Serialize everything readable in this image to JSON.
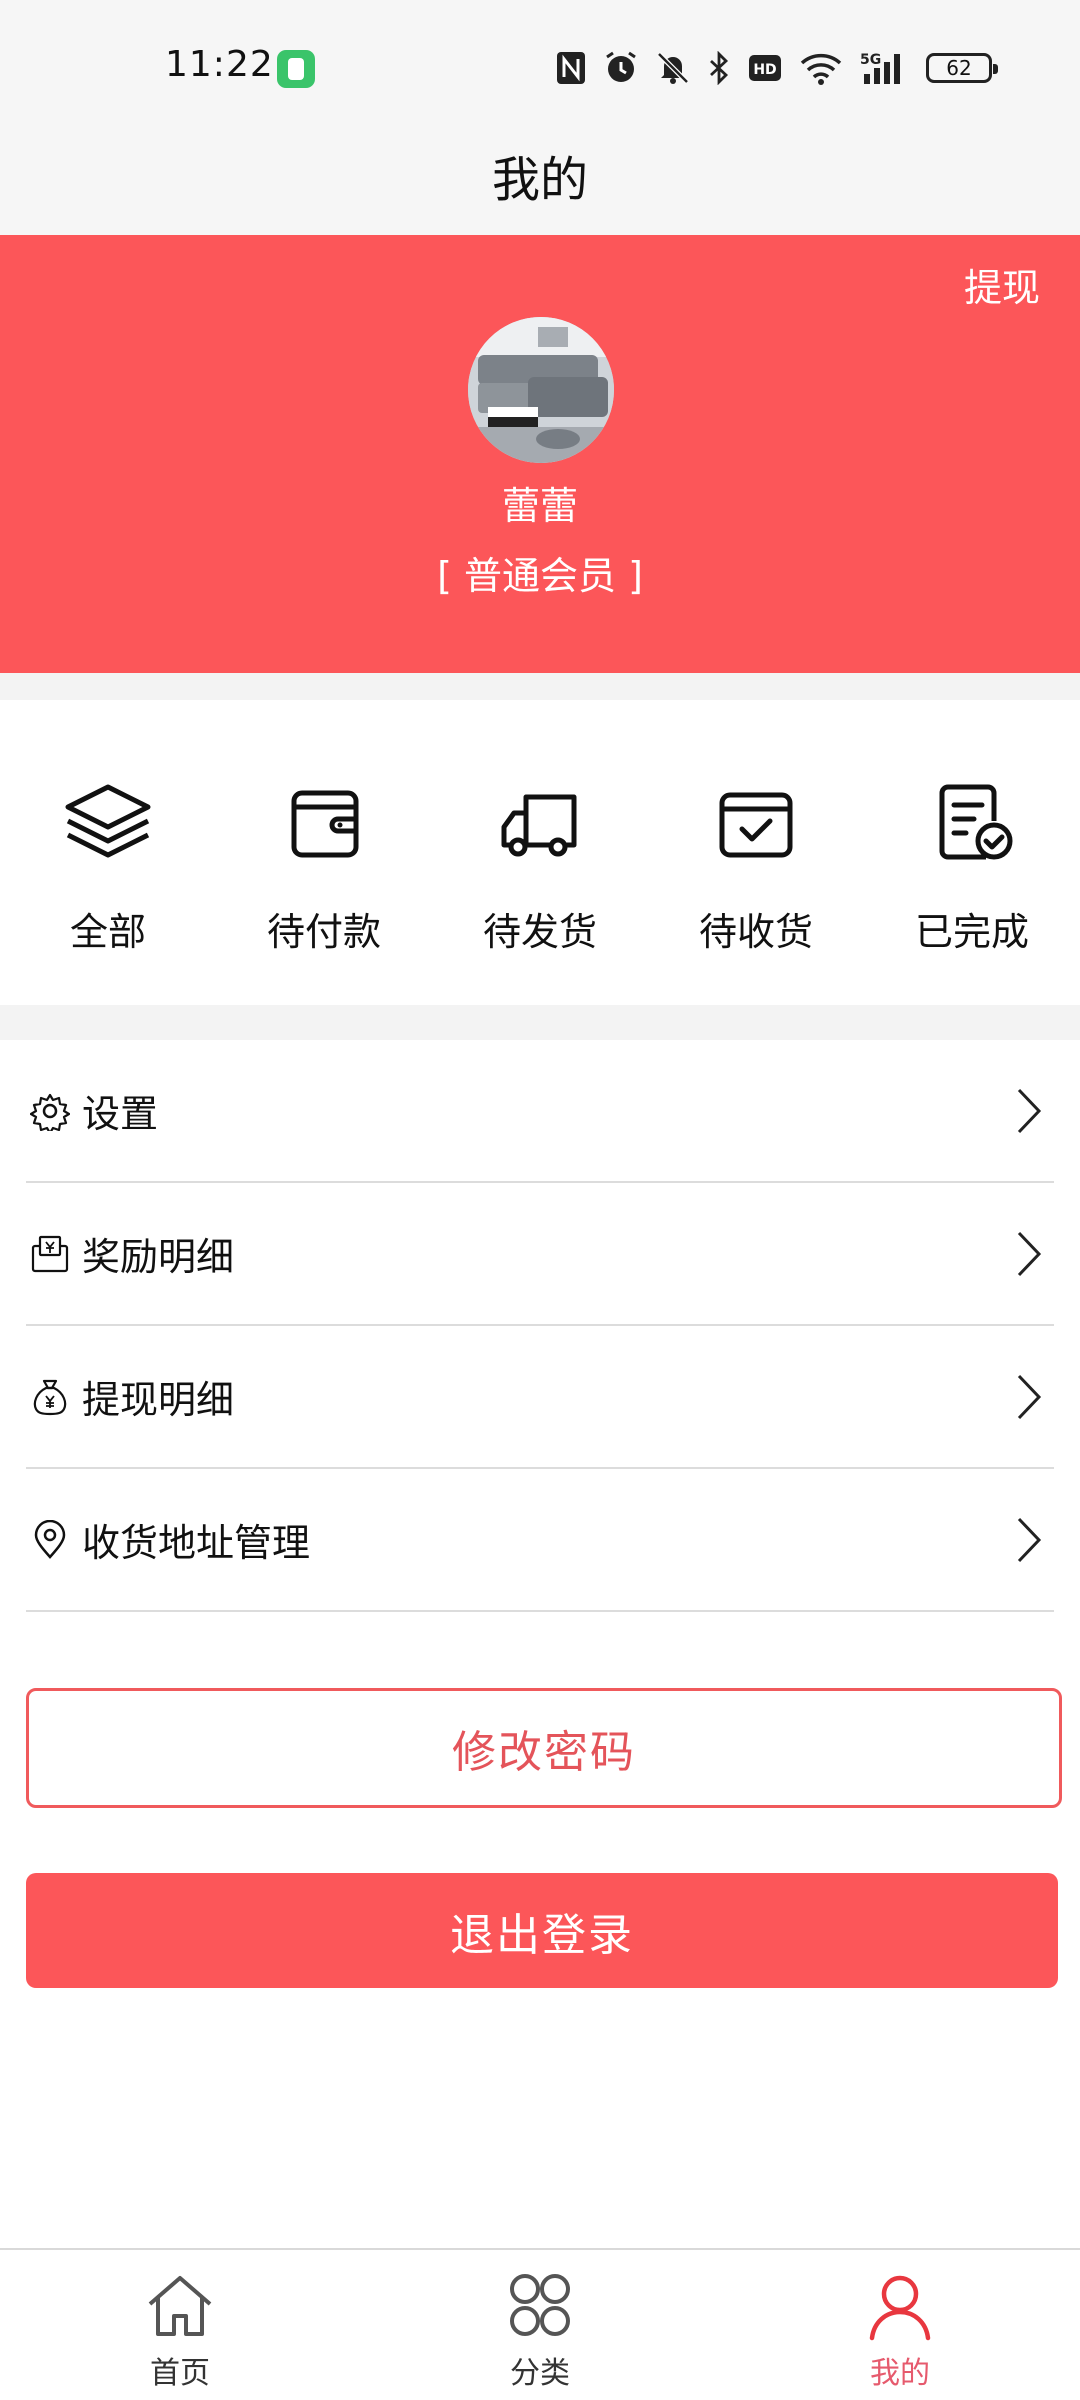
{
  "status_bar": {
    "time": "11:22",
    "icons": [
      "nfc-icon",
      "alarm-icon",
      "mute-icon",
      "bluetooth-icon",
      "hd-icon",
      "wifi-icon",
      "signal-5g-icon",
      "battery-icon"
    ],
    "signal_label": "5G",
    "hd_label": "HD",
    "battery": "62"
  },
  "header": {
    "title": "我的"
  },
  "profile": {
    "withdraw_label": "提现",
    "username": "蕾蕾",
    "member_level": "[ 普通会员 ]"
  },
  "orders": [
    {
      "label": "全部",
      "icon": "layers-icon"
    },
    {
      "label": "待付款",
      "icon": "wallet-icon"
    },
    {
      "label": "待发货",
      "icon": "truck-icon"
    },
    {
      "label": "待收货",
      "icon": "box-check-icon"
    },
    {
      "label": "已完成",
      "icon": "document-check-icon"
    }
  ],
  "menu": [
    {
      "label": "设置",
      "icon": "gear-icon"
    },
    {
      "label": "奖励明细",
      "icon": "reward-envelope-icon"
    },
    {
      "label": "提现明细",
      "icon": "money-bag-icon"
    },
    {
      "label": "收货地址管理",
      "icon": "location-pin-icon"
    }
  ],
  "buttons": {
    "change_password": "修改密码",
    "logout": "退出登录"
  },
  "bottom_nav": [
    {
      "label": "首页",
      "icon": "home-icon",
      "active": false
    },
    {
      "label": "分类",
      "icon": "category-icon",
      "active": false
    },
    {
      "label": "我的",
      "icon": "user-icon",
      "active": true
    }
  ],
  "colors": {
    "accent": "#fc5659",
    "nav_active": "#e65a6d",
    "divider": "#dcdcdc"
  }
}
